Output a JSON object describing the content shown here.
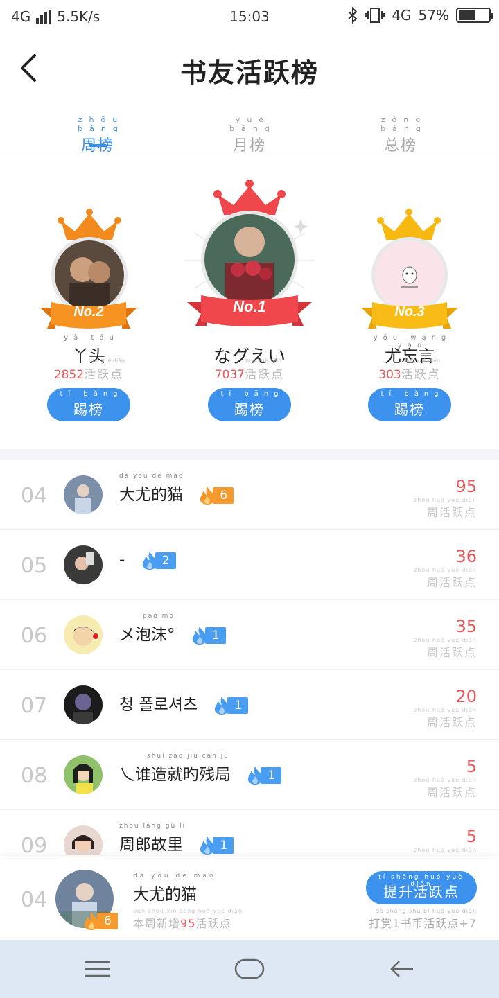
{
  "status": {
    "network": "4G",
    "speed": "5.5K/s",
    "time": "15:03",
    "right_network": "4G",
    "battery_percent": "57%",
    "battery_level": 0.57
  },
  "header": {
    "title": "书友活跃榜"
  },
  "tabs": [
    {
      "pinyin": "zhōu bǎng",
      "label": "周榜",
      "active": true
    },
    {
      "pinyin": "yuè bǎng",
      "label": "月榜",
      "active": false
    },
    {
      "pinyin": "zǒng bǎng",
      "label": "总榜",
      "active": false
    }
  ],
  "podium": {
    "first": {
      "rank_label": "No.1",
      "name": "なグえい",
      "name_pinyin": "",
      "score": "7037",
      "unit": "活跃点",
      "unit_pinyin": "huó yuè diǎn",
      "button_pinyin": "tī bǎng",
      "button": "踢榜"
    },
    "second": {
      "rank_label": "No.2",
      "name": "丫头",
      "name_pinyin": "yā tóu",
      "score": "2852",
      "unit": "活跃点",
      "unit_pinyin": "huó yuè diǎn",
      "button_pinyin": "tī bǎng",
      "button": "踢榜"
    },
    "third": {
      "rank_label": "No.3",
      "name": "尤忘言",
      "name_pinyin": "yóu wàng yán",
      "score": "303",
      "unit": "活跃点",
      "unit_pinyin": "huó yuè diǎn",
      "button_pinyin": "tī bǎng",
      "button": "踢榜"
    }
  },
  "list": {
    "unit": "周活跃点",
    "unit_pinyin": "zhōu huó yuè diǎn",
    "rows": [
      {
        "rank": "04",
        "name": "大尤的猫",
        "name_pinyin": "dà  yóu  de  māo",
        "badge": "6",
        "badge_color": "orange",
        "score": "95"
      },
      {
        "rank": "05",
        "name": "-",
        "name_pinyin": "",
        "badge": "2",
        "badge_color": "blue",
        "score": "36"
      },
      {
        "rank": "06",
        "name": "メ泡沫°",
        "name_pinyin": "pào  mò",
        "badge": "1",
        "badge_color": "blue",
        "score": "35"
      },
      {
        "rank": "07",
        "name": "청 폴로셔츠",
        "name_pinyin": "",
        "badge": "1",
        "badge_color": "blue",
        "score": "20"
      },
      {
        "rank": "08",
        "name": "乀谁造就旳残局",
        "name_pinyin": "shuí zào jiù  cán  jú",
        "badge": "1",
        "badge_color": "blue",
        "score": "5"
      },
      {
        "rank": "09",
        "name": "周郎故里",
        "name_pinyin": "zhōu láng gù  lǐ",
        "badge": "1",
        "badge_color": "blue",
        "score": "5"
      }
    ]
  },
  "me": {
    "rank": "04",
    "name": "大尤的猫",
    "name_pinyin": "dà  yóu  de  māo",
    "badge": "6",
    "added_prefix": "本周新增",
    "added_num": "95",
    "added_suffix": "活跃点",
    "added_pinyin": "běn zhōu xīn zēng    huó yuè diǎn",
    "boost_pinyin": "tí shēng huó yuè diǎn",
    "boost_label": "提升活跃点",
    "tip": "打赏1书币活跃点+7",
    "tip_pinyin": "dǎ shǎng  shū bì huó yuè diǎn"
  },
  "colors": {
    "accent": "#3d92ee",
    "score_red": "#e8575a",
    "badge_orange": "#f79a2e",
    "badge_blue": "#4a9ef2"
  },
  "icons": [
    "signal-icon",
    "bluetooth-icon",
    "vibrate-icon",
    "battery-icon",
    "back-arrow-icon",
    "crown-icon",
    "flame-icon",
    "menu-icon",
    "home-icon",
    "back-nav-icon"
  ]
}
